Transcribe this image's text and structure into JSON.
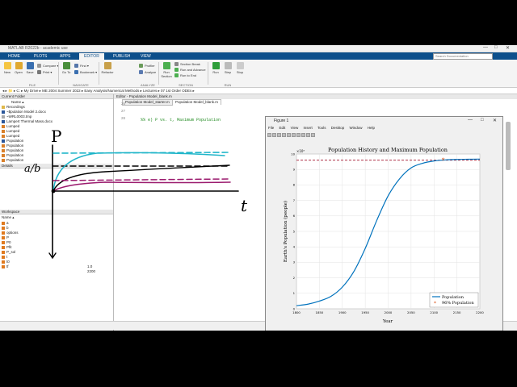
{
  "window": {
    "title": "MATLAB R2022b - academic use",
    "controls": [
      "—",
      "□",
      "✕"
    ]
  },
  "toptabs": [
    "HOME",
    "PLOTS",
    "APPS",
    "EDITOR",
    "PUBLISH",
    "VIEW"
  ],
  "active_tab": "EDITOR",
  "search_placeholder": "Search Documentation",
  "ribbon": {
    "file_buttons": [
      "New",
      "Open",
      "Save"
    ],
    "file_small": [
      "Compare ▾",
      "Print ▾"
    ],
    "file_group": "FILE",
    "nav_small": [
      "Find ▾",
      "Bookmark ▾"
    ],
    "goto": "Go To",
    "nav_group": "NAVIGATE",
    "refactor": "Refactor",
    "analyze_small": [
      "Profiler",
      "Analyze"
    ],
    "analyze_group": "ANALYZE",
    "run_section": "Run Section",
    "section_small": [
      "Section Break",
      "Run and Advance",
      "Run to End"
    ],
    "section_group": "SECTION",
    "run_buttons": [
      "Run",
      "Step",
      "Stop"
    ],
    "run_group": "RUN"
  },
  "address": "◂ ▸  📁 ▸ C: ▸ My Drive ▸ ME 2004 Summer 2022 ▸ Easy Analysis/Numerical Methods ▸ Lectures ▸ 07 1st Order ODEs ▸",
  "left_panel": {
    "current_folder_label": "Current Folder",
    "name_header": "Name ▴",
    "files": [
      "Recordings",
      "~$pulation Model 2.docx",
      "~WRL0003.tmp",
      "Lampert Thermal Mass.docx",
      "Lumped",
      "Lumped",
      "Lumped",
      "Population",
      "Population",
      "Population",
      "Population",
      "Population"
    ],
    "details_label": "Details",
    "workspace_label": "Workspace",
    "ws_name_header": "Name ▴",
    "variables": [
      "a",
      "b",
      "options",
      "P",
      "P0",
      "Pfit",
      "P_sol",
      "t",
      "t0",
      "tf"
    ],
    "values_partial": [
      "1.0",
      "2200"
    ]
  },
  "editor": {
    "header": "Editor - Population Model_blank.m",
    "tabs": [
      "Population Model_starter.m",
      "Population Model_blank.m"
    ],
    "line_numbers": [
      "26",
      "27",
      "28"
    ],
    "code_line": "%% e) P vs. t, Maximum Population"
  },
  "status": {
    "zoom": "Zoom: 100%",
    "encoding": "UTF-8",
    "eol": "CRLF",
    "mode": "script",
    "ln": "Ln",
    "ln_val": "28",
    "col": "Col",
    "col_val": "1"
  },
  "sketch": {
    "p_label": "P",
    "ab_label": "a/b",
    "t_label": "t"
  },
  "figure": {
    "title": "Figure 1",
    "menu": [
      "File",
      "Edit",
      "View",
      "Insert",
      "Tools",
      "Desktop",
      "Window",
      "Help"
    ]
  },
  "chart_data": {
    "type": "line",
    "title": "Population History and Maximum Population",
    "xlabel": "Year",
    "ylabel": "Earth's Population (people)",
    "y_exponent": "×10⁹",
    "xlim": [
      1800,
      2200
    ],
    "ylim": [
      0,
      10
    ],
    "x_ticks": [
      "1800",
      "1850",
      "1900",
      "1950",
      "2000",
      "2050",
      "2100",
      "2150",
      "2200"
    ],
    "y_ticks": [
      "0",
      "1",
      "2",
      "3",
      "4",
      "5",
      "6",
      "7",
      "8",
      "9",
      "10"
    ],
    "grid": true,
    "legend_position": "bottom-right",
    "series": [
      {
        "name": "Population",
        "color": "#0072bd",
        "x": [
          1800,
          1825,
          1850,
          1875,
          1900,
          1925,
          1950,
          1975,
          2000,
          2025,
          2050,
          2075,
          2100,
          2125,
          2150,
          2175,
          2200
        ],
        "y": [
          0.2,
          0.3,
          0.5,
          0.8,
          1.4,
          2.4,
          3.9,
          5.7,
          7.3,
          8.4,
          9.1,
          9.4,
          9.55,
          9.62,
          9.65,
          9.66,
          9.67
        ]
      },
      {
        "name": "96% Population",
        "color": "#d95319",
        "marker": "asterisk",
        "x": [
          2120
        ],
        "y": [
          9.6
        ]
      }
    ],
    "reference_line": {
      "y": 9.6,
      "style": "dashed",
      "color": "#a2142f"
    }
  }
}
